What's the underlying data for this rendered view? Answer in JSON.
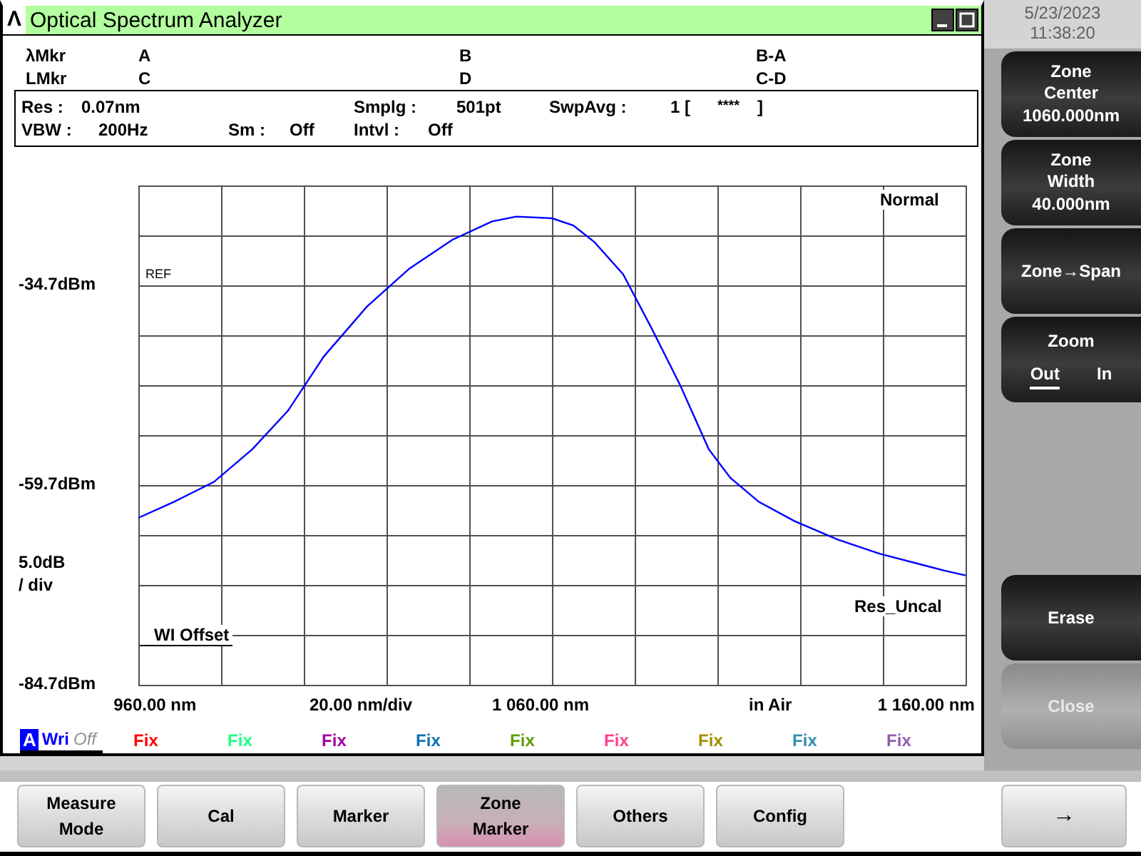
{
  "window": {
    "icon": "Λ",
    "title": "Optical Spectrum Analyzer"
  },
  "markers": [
    {
      "name": "λMkr",
      "first": "A",
      "second": "B",
      "difference": "B-A"
    },
    {
      "name": "LMkr",
      "first": "C",
      "second": "D",
      "difference": "C-D"
    }
  ],
  "settings": {
    "res_label": "Res :",
    "res": "0.07nm",
    "smplg_label": "Smplg :",
    "smplg": "501pt",
    "swpavg_label": "SwpAvg :",
    "swpavg": "1 [",
    "swpavg_count": "****",
    "swpavg_close": "]",
    "vbw_label": "VBW :",
    "vbw": "200Hz",
    "sm_label": "Sm :",
    "sm": "Off",
    "intvl_label": "Intvl :",
    "intvl": "Off"
  },
  "plot": {
    "scale": "5.0dB",
    "scale_unit": "/ div",
    "ref": "REF",
    "mode": "Normal",
    "res_status": "Res_Uncal",
    "offset": "WI Offset",
    "x_div": "20.00 nm/div",
    "medium": "in Air",
    "chart_data": {
      "type": "line",
      "xlim": [
        955.7,
        1170.2
      ],
      "ylim": [
        -84.7,
        -22.2
      ],
      "xticks": [
        {
          "value": 960,
          "label": "960.00 nm"
        },
        {
          "value": 1060,
          "label": "1 060.00 nm"
        },
        {
          "value": 1160,
          "label": "1 160.00 nm"
        }
      ],
      "yticks": [
        {
          "value": -34.7,
          "label": "-34.7dBm"
        },
        {
          "value": -59.7,
          "label": "-59.7dBm"
        },
        {
          "value": -84.7,
          "label": "-84.7dBm"
        }
      ],
      "x": [
        955.7,
        964.9,
        975.3,
        985.3,
        994.5,
        1003.8,
        1014.9,
        1026.0,
        1037.1,
        1047.4,
        1053.7,
        1063.0,
        1068.5,
        1074.0,
        1081.4,
        1088.8,
        1096.2,
        1103.6,
        1109.2,
        1116.6,
        1125.8,
        1136.9,
        1148.0,
        1159.1,
        1164.7,
        1170.2
      ],
      "series": [
        {
          "name": "A",
          "color": "#0000ff",
          "values": [
            -63.8,
            -61.8,
            -59.3,
            -55.2,
            -50.4,
            -43.6,
            -37.4,
            -32.6,
            -29.0,
            -26.7,
            -26.1,
            -26.3,
            -27.2,
            -29.3,
            -33.3,
            -40.1,
            -47.2,
            -55.2,
            -58.8,
            -61.8,
            -64.2,
            -66.5,
            -68.3,
            -69.7,
            -70.4,
            -71.0
          ]
        }
      ]
    }
  },
  "active_trace": {
    "mode": "Wri",
    "display": "Off"
  },
  "traces": [
    {
      "label": "Fix",
      "color": "#ff0000"
    },
    {
      "label": "Fix",
      "color": "#20ff80"
    },
    {
      "label": "Fix",
      "color": "#a000a0"
    },
    {
      "label": "Fix",
      "color": "#1070b0"
    },
    {
      "label": "Fix",
      "color": "#60a000"
    },
    {
      "label": "Fix",
      "color": "#ff4090"
    },
    {
      "label": "Fix",
      "color": "#a09000"
    },
    {
      "label": "Fix",
      "color": "#3090b0"
    },
    {
      "label": "Fix",
      "color": "#9060b0"
    }
  ],
  "clock": {
    "date": "5/23/2023",
    "time": "11:38:20"
  },
  "softkeys": [
    {
      "kind": "value",
      "label": "Zone Center",
      "value": "1060.000nm"
    },
    {
      "kind": "value",
      "label": "Zone Width",
      "value": "40.000nm"
    },
    {
      "kind": "plain",
      "label": "Zone→Span"
    },
    {
      "kind": "toggle",
      "label": "Zoom",
      "options": [
        {
          "label": "Out",
          "selected": true
        },
        {
          "label": "In",
          "selected": false
        }
      ]
    }
  ],
  "lower_softkeys": [
    {
      "label": "Erase",
      "disabled": false
    },
    {
      "label": "Close",
      "disabled": true
    }
  ],
  "menu": [
    {
      "label": "Measure Mode",
      "selected": false
    },
    {
      "label": "Cal",
      "selected": false
    },
    {
      "label": "Marker",
      "selected": false
    },
    {
      "label": "Zone Marker",
      "selected": true
    },
    {
      "label": "Others",
      "selected": false
    },
    {
      "label": "Config",
      "selected": false
    }
  ],
  "next_button": "→"
}
